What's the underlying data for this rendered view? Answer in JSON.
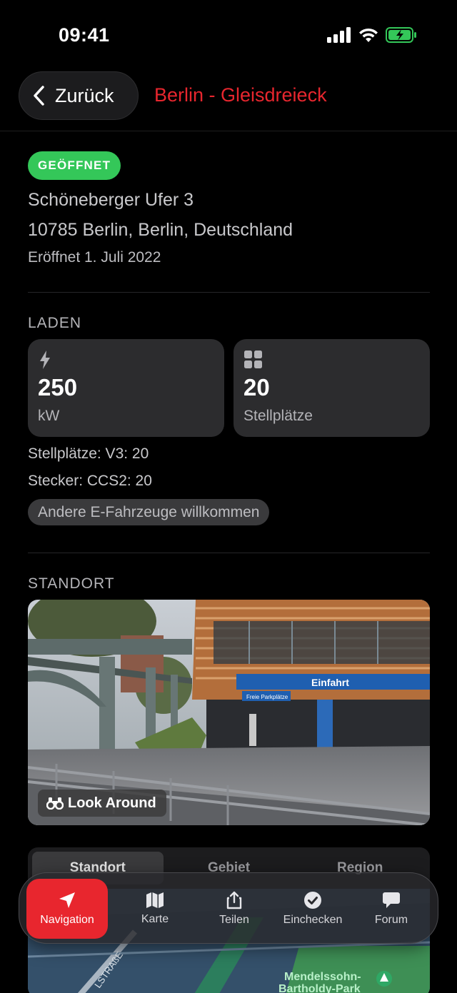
{
  "status_bar": {
    "time": "09:41"
  },
  "header": {
    "back_label": "Zurück",
    "title": "Berlin - Gleisdreieck"
  },
  "station": {
    "status_badge": "GEÖFFNET",
    "address_line1": "Schöneberger Ufer 3",
    "address_line2": "10785 Berlin, Berlin, Deutschland",
    "opened": "Eröffnet 1. Juli 2022"
  },
  "charging": {
    "section_title": "LADEN",
    "power": {
      "value": "250",
      "unit": "kW",
      "icon": "bolt-icon"
    },
    "stalls": {
      "value": "20",
      "unit": "Stellplätze",
      "icon": "grid-icon"
    },
    "stalls_detail": "Stellplätze: V3: 20",
    "connector_detail": "Stecker: CCS2: 20",
    "other_ev_pill": "Andere E-Fahrzeuge willkommen"
  },
  "location": {
    "section_title": "STANDORT",
    "photo_sign_text": "Einfahrt",
    "photo_sign_sub": "Freie Parkplätze",
    "look_around_label": "Look Around",
    "segments": [
      "Standort",
      "Gebiet",
      "Region"
    ],
    "map_labels": {
      "street": "LSTRAßE",
      "park": "Mendelssohn-Bartholdy-Park"
    }
  },
  "tabbar": {
    "items": [
      {
        "label": "Navigation",
        "icon": "navigation-arrow-icon"
      },
      {
        "label": "Karte",
        "icon": "map-icon"
      },
      {
        "label": "Teilen",
        "icon": "share-icon"
      },
      {
        "label": "Einchecken",
        "icon": "checkmark-icon"
      },
      {
        "label": "Forum",
        "icon": "chat-bubble-icon"
      }
    ]
  },
  "colors": {
    "accent_red": "#e8262e",
    "open_green": "#34c759",
    "battery_green": "#34c759"
  }
}
